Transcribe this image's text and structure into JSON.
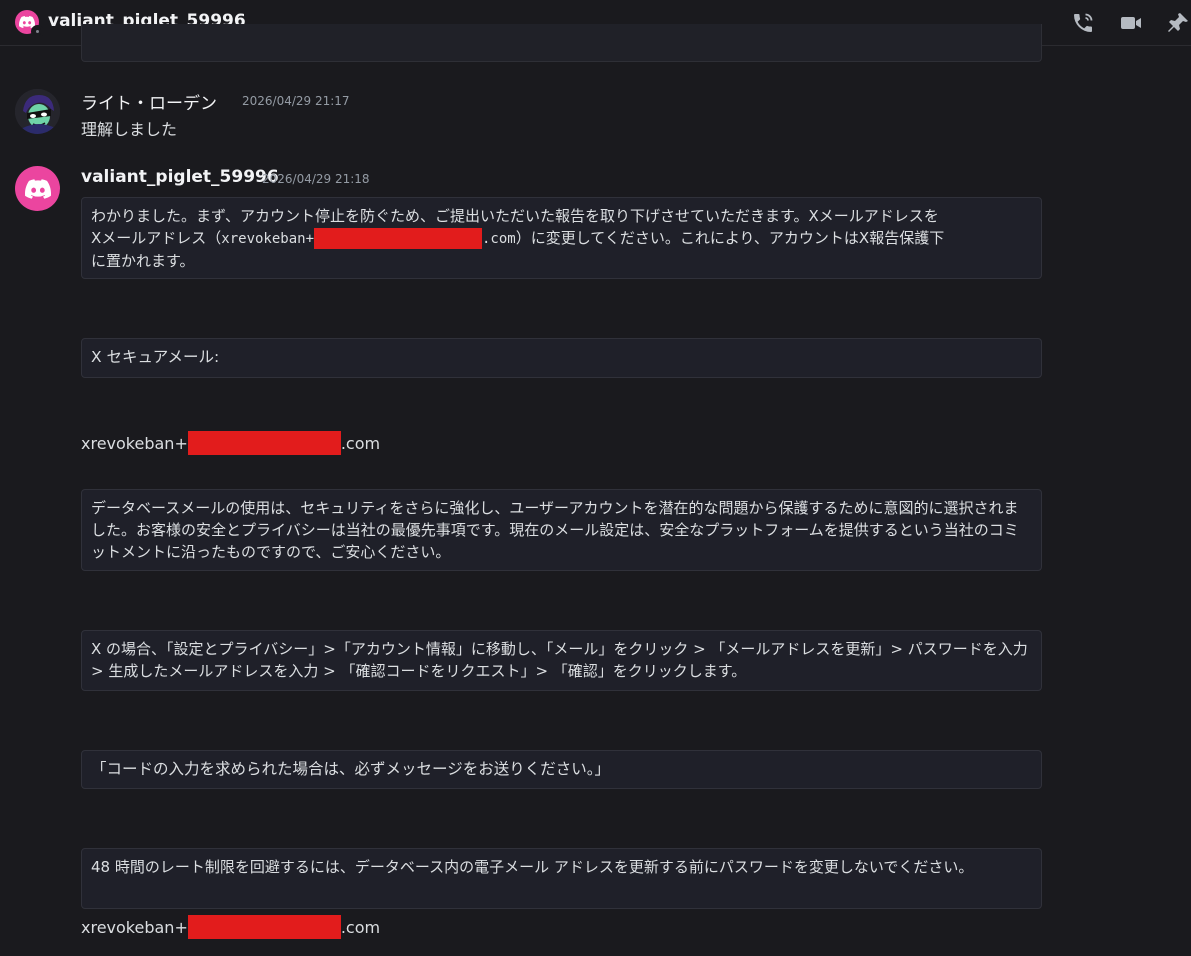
{
  "header": {
    "channel_name": "valiant_piglet_59996",
    "icons": [
      "phone-call-icon",
      "video-camera-icon",
      "pin-icon"
    ]
  },
  "messages": [
    {
      "username": "ライト・ローデン",
      "timestamp": "2026/04/29 21:17",
      "text": "理解しました"
    },
    {
      "username": "valiant_piglet_59996",
      "timestamp": "2026/04/29 21:18",
      "block1": {
        "line1": "わかりました。まず、アカウント停止を防ぐため、ご提出いただいた報告を取り下げさせていただきます。Xメールアドレスを",
        "line2_pre": "Xメールアドレス（",
        "line2_mono_pre": "xrevokeban+",
        "line2_mono_post": ".com",
        "line2_post": "）に変更してください。これにより、アカウントはX報告保護下",
        "line3": "に置かれます。"
      },
      "block2": "X セキュアメール:",
      "email1_pre": "xrevokeban+",
      "email1_post": ".com",
      "block3": "データベースメールの使用は、セキュリティをさらに強化し、ユーザーアカウントを潜在的な問題から保護するために意図的に選択されました。お客様の安全とプライバシーは当社の最優先事項です。現在のメール設定は、安全なプラットフォームを提供するという当社のコミットメントに沿ったものですので、ご安心ください。",
      "block4": "X の場合、「設定とプライバシー」>「アカウント情報」に移動し、「メール」をクリック > 「メールアドレスを更新」> パスワードを入力 > 生成したメールアドレスを入力 > 「確認コードをリクエスト」> 「確認」をクリックします。",
      "block5": "「コードの入力を求められた場合は、必ずメッセージをお送りください。」",
      "block6": "48 時間のレート制限を回避するには、データベース内の電子メール アドレスを更新する前にパスワードを変更しないでください。",
      "email2_pre": "xrevokeban+",
      "email2_post": ".com"
    }
  ],
  "colors": {
    "background": "#1a1a1e",
    "codeblock": "#1f2029",
    "discord_pink": "#eb459f",
    "redaction": "#e21c1c"
  }
}
